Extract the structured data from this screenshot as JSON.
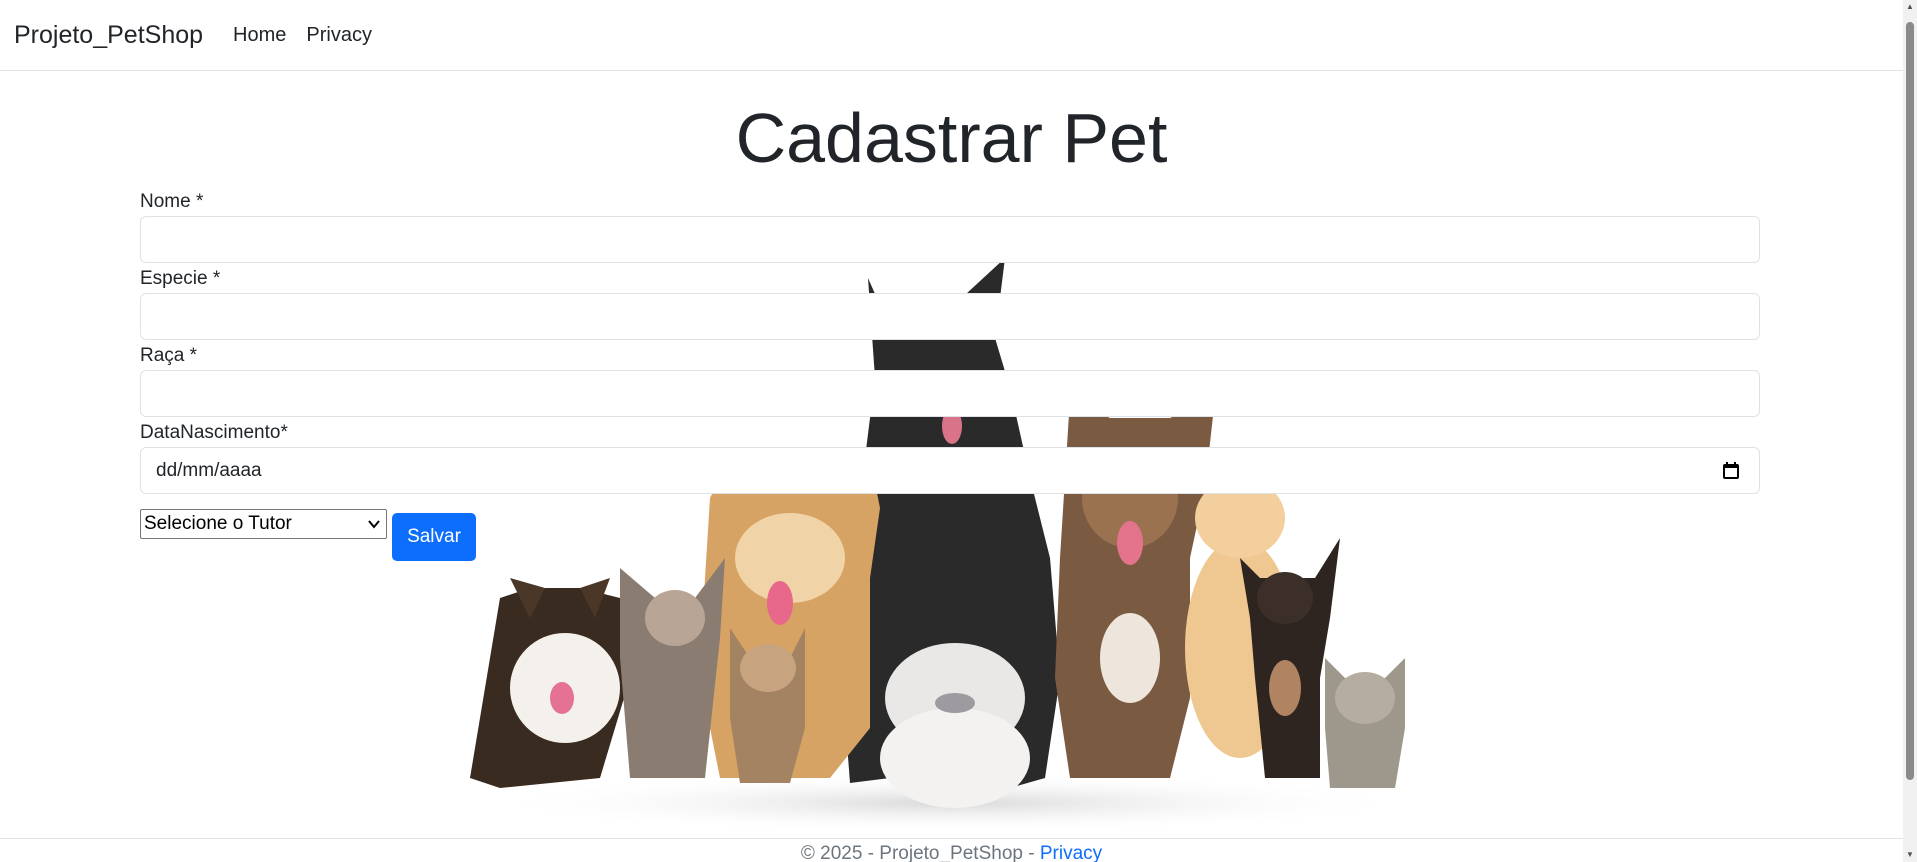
{
  "navbar": {
    "brand": "Projeto_PetShop",
    "links": [
      "Home",
      "Privacy"
    ]
  },
  "page": {
    "title": "Cadastrar Pet"
  },
  "form": {
    "nome_label": "Nome *",
    "nome_value": "",
    "especie_label": "Especie *",
    "especie_value": "",
    "raca_label": "Raça *",
    "raca_value": "",
    "data_label": "DataNascimento*",
    "data_placeholder": "dd/mm/aaaa",
    "tutor_select": "Selecione o Tutor",
    "save_label": "Salvar"
  },
  "footer": {
    "text": "© 2025 - Projeto_PetShop - ",
    "link": "Privacy"
  },
  "colors": {
    "primary": "#0d6efd",
    "border": "#dee2e6",
    "text": "#212529",
    "muted": "#6c757d"
  },
  "icons": [
    "calendar-icon",
    "chevron-down-icon"
  ]
}
